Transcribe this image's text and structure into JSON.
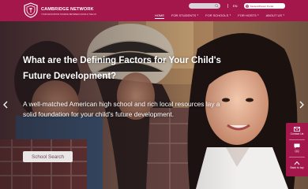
{
  "brand": {
    "title": "CAMBRIDGE NETWORK",
    "tagline": "YOUR EDUCATION SOURCE BETWEEN CHINA & THE US"
  },
  "header": {
    "search_placeholder": "",
    "language": "EN",
    "portal_label": "Student/Parent Portal"
  },
  "nav": {
    "items": [
      {
        "label": "HOME",
        "active": true,
        "has_dropdown": false
      },
      {
        "label": "FOR STUDENTS",
        "active": false,
        "has_dropdown": true
      },
      {
        "label": "FOR SCHOOLS",
        "active": false,
        "has_dropdown": true
      },
      {
        "label": "FOR HOSTS",
        "active": false,
        "has_dropdown": true
      },
      {
        "label": "ABOUT US",
        "active": false,
        "has_dropdown": true
      }
    ]
  },
  "hero": {
    "headline": "What are the Defining Factors for Your Child's Future Development?",
    "subtext": "A well-matched American high school and rich local resources lay a solid foundation for your child's future development.",
    "cta_label": "School Search"
  },
  "side_widget": {
    "contact_label": "Contact Us",
    "chat_label": "QQ",
    "top_label": "Back to top"
  },
  "colors": {
    "brand": "#a3174b",
    "header_text": "#ffffff"
  },
  "icons": {
    "logo": "shield-crest-icon",
    "search": "search-icon",
    "user": "user-icon",
    "prev": "chevron-left-icon",
    "next": "chevron-right-icon",
    "mail": "mail-icon",
    "chat": "chat-icon",
    "top": "arrow-up-icon"
  }
}
